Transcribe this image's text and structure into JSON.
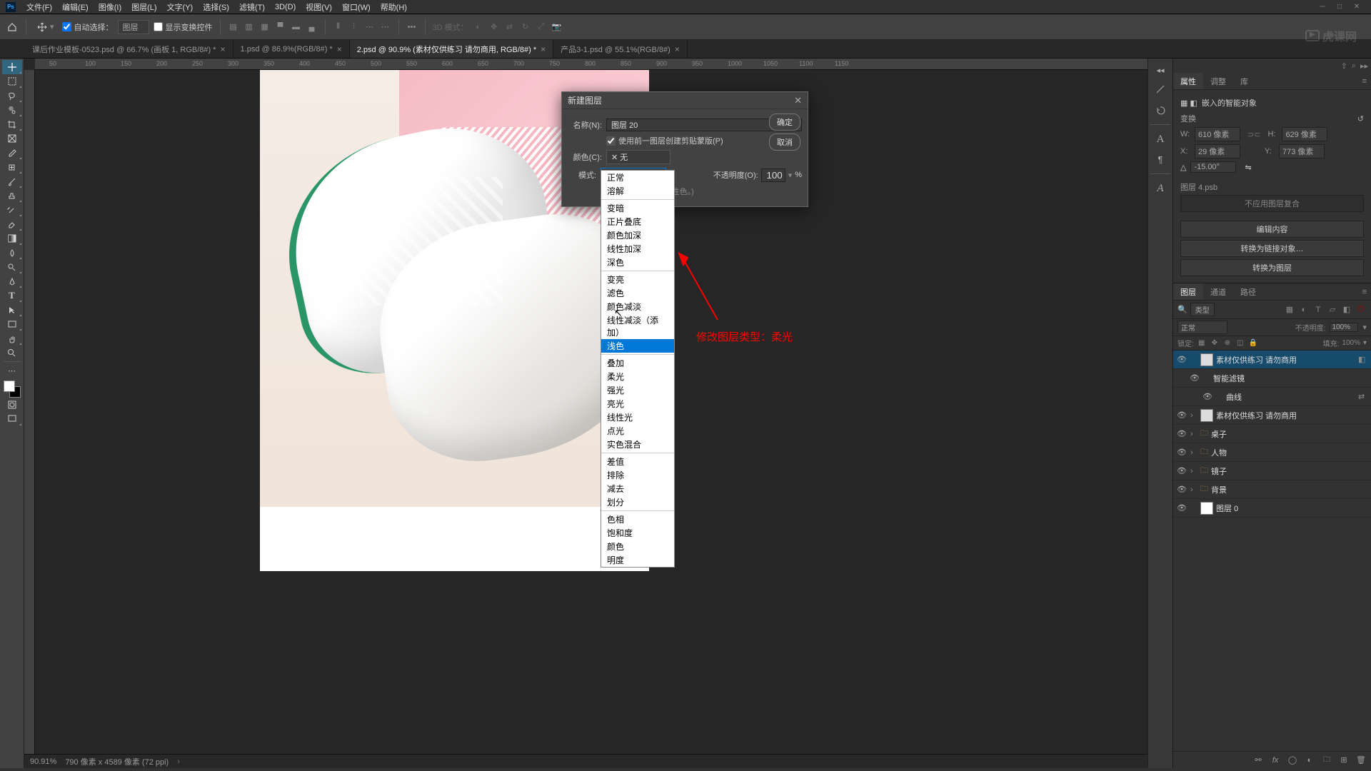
{
  "menubar": {
    "items": [
      "文件(F)",
      "编辑(E)",
      "图像(I)",
      "图层(L)",
      "文字(Y)",
      "选择(S)",
      "滤镜(T)",
      "3D(D)",
      "视图(V)",
      "窗口(W)",
      "帮助(H)"
    ]
  },
  "optionsbar": {
    "autoSelectLabel": "自动选择：",
    "autoSelectTarget": "图层",
    "showTransformLabel": "显示变换控件",
    "mode3dLabel": "3D 模式："
  },
  "tabs": [
    {
      "label": "课后作业模板-0523.psd @ 66.7% (画板 1, RGB/8#) *",
      "active": false
    },
    {
      "label": "1.psd @ 86.9%(RGB/8#) *",
      "active": false
    },
    {
      "label": "2.psd @ 90.9% (素材仅供练习 请勿商用, RGB/8#) *",
      "active": true
    },
    {
      "label": "产品3-1.psd @ 55.1%(RGB/8#)",
      "active": false
    }
  ],
  "rulerTicks": [
    "50",
    "100",
    "150",
    "200",
    "250",
    "300",
    "350",
    "400",
    "450",
    "500",
    "550",
    "600",
    "650",
    "700",
    "750",
    "800",
    "850",
    "900",
    "950",
    "1000",
    "1050",
    "1100",
    "1150"
  ],
  "dialog": {
    "title": "新建图层",
    "nameLabel": "名称(N):",
    "nameValue": "图层 20",
    "clipMaskLabel": "使用前一图层创建剪贴蒙版(P)",
    "colorLabel": "颜色(C):",
    "colorValue": "✕ 无",
    "modeLabel": "模式:",
    "modeValue": "正常",
    "opacityLabel": "不透明度(O):",
    "opacityValue": "100",
    "opacityUnit": "%",
    "neutralHint": "(正常模式不存在中性色。)",
    "okBtn": "确定",
    "cancelBtn": "取消"
  },
  "blendModes": {
    "g1": [
      "正常",
      "溶解"
    ],
    "g2": [
      "变暗",
      "正片叠底",
      "颜色加深",
      "线性加深",
      "深色"
    ],
    "g3": [
      "变亮",
      "滤色",
      "颜色减淡",
      "线性减淡（添加）",
      "浅色"
    ],
    "g4": [
      "叠加",
      "柔光",
      "强光",
      "亮光",
      "线性光",
      "点光",
      "实色混合"
    ],
    "g5": [
      "差值",
      "排除",
      "减去",
      "划分"
    ],
    "g6": [
      "色相",
      "饱和度",
      "颜色",
      "明度"
    ],
    "highlighted": "浅色"
  },
  "annotation": "修改图层类型：柔光",
  "statusbar": {
    "zoom": "90.91%",
    "docInfo": "790 像素 x 4589 像素 (72 ppi)"
  },
  "properties": {
    "tabs": {
      "prop": "属性",
      "adjust": "调整",
      "lib": "库"
    },
    "header": "嵌入的智能对象",
    "transformTitle": "变换",
    "w": "610 像素",
    "h": "629 像素",
    "x": "29 像素",
    "y": "773 像素",
    "angle": "-15.00°",
    "layerName": "图层 4.psb",
    "noComp": "不应用图层复合",
    "btnEdit": "编辑内容",
    "btnConvertLink": "转换为链接对象…",
    "btnConvertLayer": "转换为图层"
  },
  "layersPanel": {
    "tabs": {
      "layers": "图层",
      "channels": "通道",
      "paths": "路径"
    },
    "filterType": "类型",
    "blendMode": "正常",
    "opacityLabel": "不透明度:",
    "opacityVal": "100%",
    "lockLabel": "锁定:",
    "fillLabel": "填充:",
    "fillVal": "100%",
    "layers": [
      {
        "name": "素材仅供练习 请勿商用",
        "indent": 0,
        "active": true,
        "eye": true,
        "thumb": "light",
        "hasLink": true
      },
      {
        "name": "智能滤镜",
        "indent": 1,
        "eye": true,
        "thumb": "none"
      },
      {
        "name": "曲线",
        "indent": 2,
        "eye": true,
        "thumb": "none",
        "hasToggle": true
      },
      {
        "name": "素材仅供练习 请勿商用",
        "indent": 0,
        "eye": true,
        "thumb": "light",
        "arrow": true
      },
      {
        "name": "桌子",
        "indent": 0,
        "eye": true,
        "thumb": "folder",
        "arrow": true
      },
      {
        "name": "人物",
        "indent": 0,
        "eye": true,
        "thumb": "folder",
        "arrow": true
      },
      {
        "name": "镜子",
        "indent": 0,
        "eye": true,
        "thumb": "folder",
        "arrow": true
      },
      {
        "name": "背景",
        "indent": 0,
        "eye": true,
        "thumb": "folder",
        "arrow": true
      },
      {
        "name": "图层 0",
        "indent": 0,
        "eye": true,
        "thumb": "white"
      }
    ]
  },
  "watermark": "虎课网"
}
